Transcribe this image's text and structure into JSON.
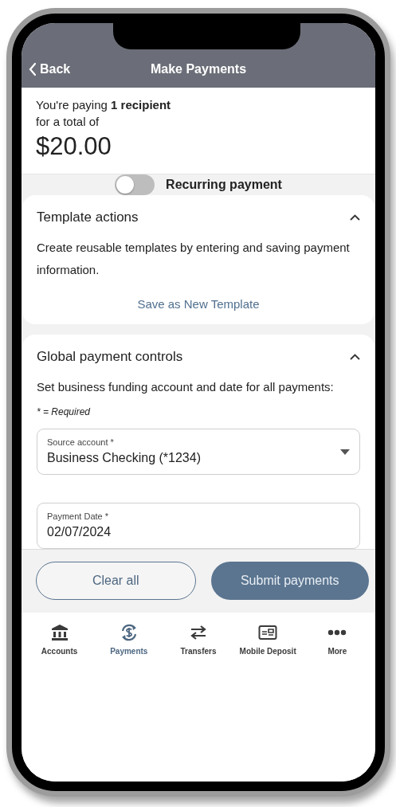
{
  "header": {
    "back_label": "Back",
    "title": "Make Payments"
  },
  "summary": {
    "text": "You're paying **1 recipient**",
    "subtext": "for a total of",
    "total": "$20.00"
  },
  "recurring": {
    "label": "Recurring payment",
    "on": false
  },
  "sections": [
    {
      "title": "Template actions",
      "expanded": true,
      "description": "Create reusable templates by entering and saving payment information.",
      "link": "Save as New Template"
    },
    {
      "title": "Global payment controls",
      "expanded": true,
      "description": "Set business funding account and date for all payments:",
      "note": "* = Required",
      "fields": [
        {
          "kind": "select",
          "label": "Source account *",
          "value": "Business Checking (*1234)"
        },
        {
          "kind": "text",
          "label": "Payment Date *",
          "value": "02/07/2024"
        }
      ]
    }
  ],
  "actions": [
    {
      "kind": "secondary",
      "label": "Clear all"
    },
    {
      "kind": "primary",
      "label": "Submit payments"
    }
  ],
  "nav": [
    {
      "kind": "bank",
      "label": "Accounts",
      "selected": false
    },
    {
      "kind": "payments",
      "label": "Payments",
      "selected": true
    },
    {
      "kind": "transfers",
      "label": "Transfers",
      "selected": false
    },
    {
      "kind": "deposit",
      "label": "Mobile Deposit",
      "selected": false
    },
    {
      "kind": "more",
      "label": "More",
      "selected": false
    }
  ]
}
